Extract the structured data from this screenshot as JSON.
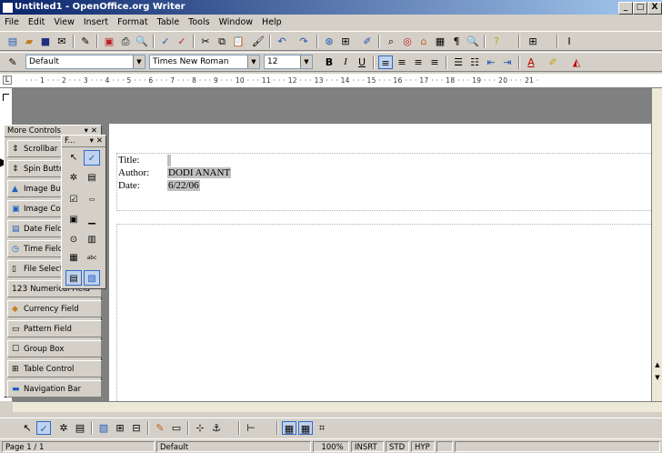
{
  "window": {
    "title": "Untitled1 - OpenOffice.org Writer",
    "controls": [
      "_",
      "□",
      "X"
    ]
  },
  "menu": [
    "File",
    "Edit",
    "View",
    "Insert",
    "Format",
    "Table",
    "Tools",
    "Window",
    "Help"
  ],
  "formatting": {
    "style": "Default",
    "font": "Times New Roman",
    "size": "12"
  },
  "ruler": {
    "marks": "· · · 1 · · · 2 · · · 3 · · · 4 · · · 5 · · · 6 · · · 7 · · · 8 · · · 9 · · · 10 · · · 11 · · · 12 · · · 13 · · · 14 · · · 15 · · · 16 · · · 17 · · · 18 · · · 19 · · · 20 · · · 21 ·"
  },
  "document": {
    "fields": [
      {
        "label": "Title:",
        "value": ""
      },
      {
        "label": "Author:",
        "value": "DODI ANANT"
      },
      {
        "label": "Date:",
        "value": "6/22/06"
      }
    ]
  },
  "more_controls": {
    "title": "More Controls",
    "items": [
      {
        "label": "Scrollbar",
        "icon": "scrollbar-icon"
      },
      {
        "label": "Spin Button",
        "icon": "spin-button-icon"
      },
      {
        "label": "Image Button",
        "icon": "image-button-icon"
      },
      {
        "label": "Image Control",
        "icon": "image-control-icon"
      },
      {
        "label": "Date Field",
        "icon": "date-field-icon"
      },
      {
        "label": "Time Field",
        "icon": "time-field-icon"
      },
      {
        "label": "File Selection",
        "icon": "file-selection-icon"
      },
      {
        "label": "Numerical Field",
        "icon": "numeric-field-icon",
        "icon_text": "123"
      },
      {
        "label": "Currency Field",
        "icon": "currency-field-icon"
      },
      {
        "label": "Pattern Field",
        "icon": "pattern-field-icon"
      },
      {
        "label": "Group Box",
        "icon": "group-box-icon"
      },
      {
        "label": "Table Control",
        "icon": "table-control-icon"
      },
      {
        "label": "Navigation Bar",
        "icon": "navigation-bar-icon"
      }
    ]
  },
  "form_controls": {
    "title": "F..."
  },
  "status": {
    "page": "Page 1 / 1",
    "style": "Default",
    "zoom": "100%",
    "mode": "INSRT",
    "selection": "STD",
    "hyperlink": "HYP"
  }
}
